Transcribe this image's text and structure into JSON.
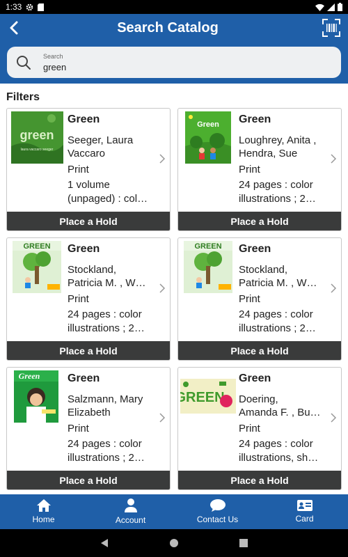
{
  "status": {
    "time": "1:33"
  },
  "header": {
    "title": "Search Catalog"
  },
  "search": {
    "label": "Search",
    "value": "green"
  },
  "filters_label": "Filters",
  "results": [
    {
      "title": "Green",
      "author_lines": [
        "Seeger, Laura",
        "Vaccaro"
      ],
      "format": "Print",
      "desc_lines": [
        "1 volume",
        "(unpaged) : col…"
      ],
      "button": "Place a Hold",
      "cover": "green-leaf"
    },
    {
      "title": "Green",
      "author_lines": [
        "Loughrey, Anita ,",
        "Hendra, Sue"
      ],
      "format": "Print",
      "desc_lines": [
        "24 pages : color",
        "illustrations ; 2…"
      ],
      "button": "Place a Hold",
      "cover": "green-kids"
    },
    {
      "title": "Green",
      "author_lines": [
        "Stockland,",
        "Patricia M. , W…"
      ],
      "format": "Print",
      "desc_lines": [
        "24 pages : color",
        "illustrations ; 2…"
      ],
      "button": "Place a Hold",
      "cover": "green-tree"
    },
    {
      "title": "Green",
      "author_lines": [
        "Stockland,",
        "Patricia M. , W…"
      ],
      "format": "Print",
      "desc_lines": [
        "24 pages : color",
        "illustrations ; 2…"
      ],
      "button": "Place a Hold",
      "cover": "green-tree"
    },
    {
      "title": "Green",
      "author_lines": [
        "Salzmann, Mary",
        "Elizabeth"
      ],
      "format": "Print",
      "desc_lines": [
        "24 pages : color",
        "illustrations ; 2…"
      ],
      "button": "Place a Hold",
      "cover": "green-girl"
    },
    {
      "title": "Green",
      "author_lines": [
        "Doering,",
        "Amanda F. , Bu…"
      ],
      "format": "Print",
      "desc_lines": [
        "24 pages : color",
        "illustrations, sh…"
      ],
      "button": "Place a Hold",
      "cover": "green-text"
    }
  ],
  "bottom_nav": [
    {
      "label": "Home",
      "icon": "home-icon"
    },
    {
      "label": "Account",
      "icon": "account-icon"
    },
    {
      "label": "Contact Us",
      "icon": "chat-icon"
    },
    {
      "label": "Card",
      "icon": "card-icon"
    }
  ],
  "colors": {
    "primary": "#1f5fa8",
    "hold_button": "#3a3b3b"
  }
}
